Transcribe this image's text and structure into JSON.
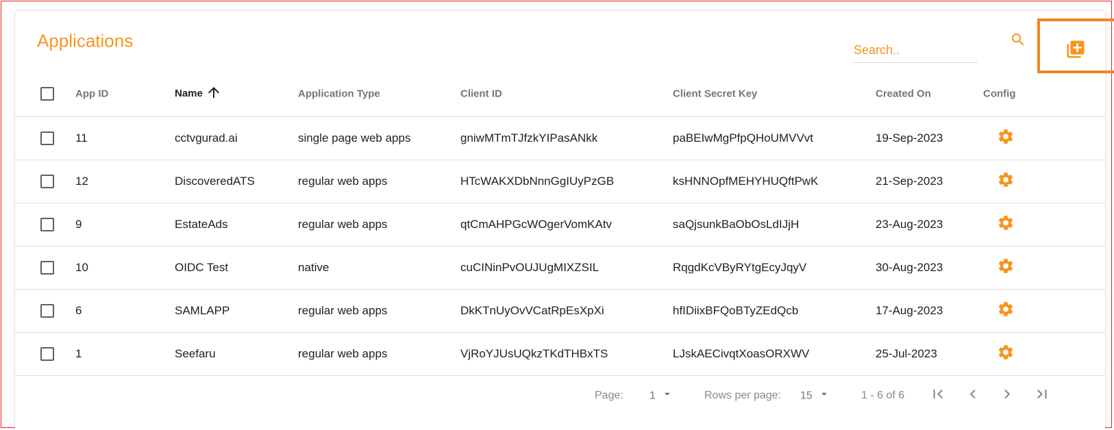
{
  "page": {
    "title": "Applications",
    "accent_color": "#f7941d",
    "highlight_color": "#f58322"
  },
  "search": {
    "placeholder": "Search..",
    "icon": "search-icon"
  },
  "toolbar": {
    "add_icon": "library-add-icon"
  },
  "table": {
    "columns": {
      "app_id": "App ID",
      "name": "Name",
      "application_type": "Application Type",
      "client_id": "Client ID",
      "client_secret": "Client Secret Key",
      "created_on": "Created On",
      "config": "Config"
    },
    "sort": {
      "column": "Name",
      "direction": "ascending",
      "icon": "arrow-up-icon"
    },
    "config_icon": "gear-icon",
    "rows": [
      {
        "app_id": "11",
        "name": "cctvgurad.ai",
        "application_type": "single page web apps",
        "client_id": "gniwMTmTJfzkYIPasANkk",
        "client_secret": "paBEIwMgPfpQHoUMVVvt",
        "created_on": "19-Sep-2023"
      },
      {
        "app_id": "12",
        "name": "DiscoveredATS",
        "application_type": "regular web apps",
        "client_id": "HTcWAKXDbNnnGgIUyPzGB",
        "client_secret": "ksHNNOpfMEHYHUQftPwK",
        "created_on": "21-Sep-2023"
      },
      {
        "app_id": "9",
        "name": "EstateAds",
        "application_type": "regular web apps",
        "client_id": "qtCmAHPGcWOgerVomKAtv",
        "client_secret": "saQjsunkBaObOsLdIJjH",
        "created_on": "23-Aug-2023"
      },
      {
        "app_id": "10",
        "name": "OIDC Test",
        "application_type": "native",
        "client_id": "cuCINinPvOUJUgMIXZSIL",
        "client_secret": "RqgdKcVByRYtgEcyJqyV",
        "created_on": "30-Aug-2023"
      },
      {
        "app_id": "6",
        "name": "SAMLAPP",
        "application_type": "regular web apps",
        "client_id": "DkKTnUyOvVCatRpEsXpXi",
        "client_secret": "hfIDiixBFQoBTyZEdQcb",
        "created_on": "17-Aug-2023"
      },
      {
        "app_id": "1",
        "name": "Seefaru",
        "application_type": "regular web apps",
        "client_id": "VjRoYJUsUQkzTKdTHBxTS",
        "client_secret": "LJskAECivqtXoasORXWV",
        "created_on": "25-Jul-2023"
      }
    ]
  },
  "pagination": {
    "page_label": "Page:",
    "page_value": "1",
    "rows_label": "Rows per page:",
    "rows_value": "15",
    "range": "1 - 6 of 6",
    "icons": [
      "first-page-icon",
      "chevron-left-icon",
      "chevron-right-icon",
      "last-page-icon",
      "dropdown-arrow-icon"
    ]
  }
}
